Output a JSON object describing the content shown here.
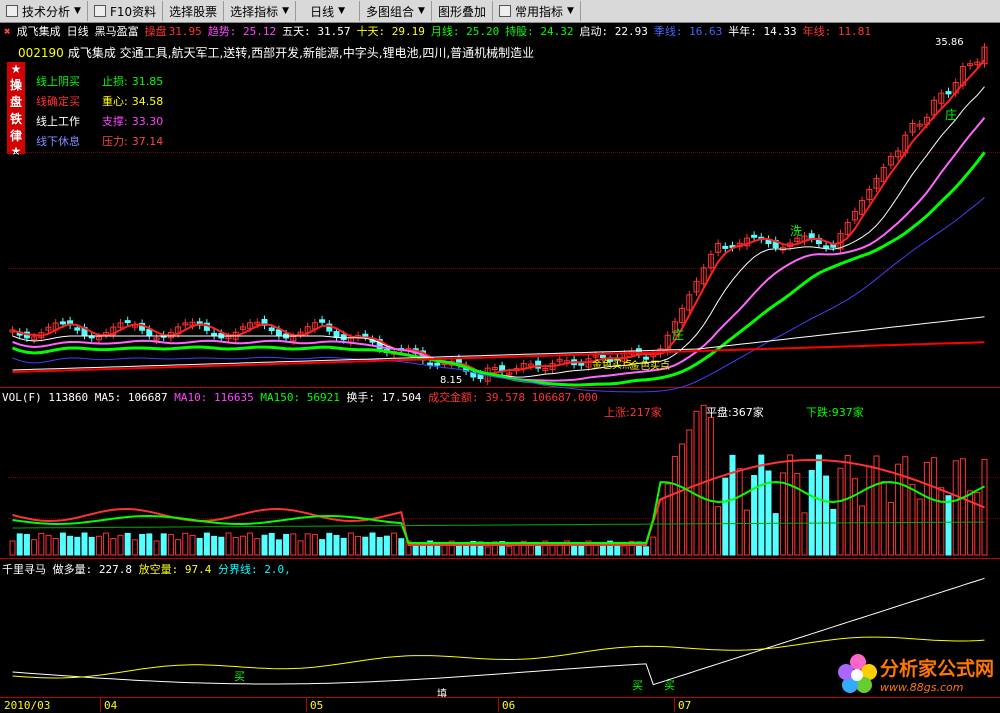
{
  "toolbar": {
    "items": [
      "技术分析",
      "F10资料",
      "选择股票",
      "选择指标",
      "日线",
      "多图组合",
      "图形叠加",
      "常用指标"
    ]
  },
  "titlebar": {
    "close_glyph": "✖",
    "stock_name": "成飞集成",
    "period": "日线",
    "formula": "黑马盈富",
    "operate_label": "操盘",
    "operate_value": "31.95",
    "trend": "趋势: 25.12",
    "day5": "五天: 31.57",
    "day10": "十天: 29.19",
    "month": "月线: 25.20",
    "hold": "持股: 24.32",
    "start": "启动: 22.93",
    "season": "季线: 16.63",
    "halfyear": "半年: 14.33",
    "year": "年线: 11.81"
  },
  "concept": {
    "code": "002190",
    "text": "成飞集成 交通工具,航天军工,送转,西部开发,新能源,中字头,锂电池,四川,普通机械制造业"
  },
  "badge": [
    "★",
    "操",
    "盘",
    "铁",
    "律",
    "★"
  ],
  "legend": [
    {
      "label": "线上阴买",
      "name": "止损:",
      "value": "31.85",
      "label_color": "#00ff00",
      "name_color": "#00ff00"
    },
    {
      "label": "线确定买",
      "name": "重心:",
      "value": "34.58",
      "label_color": "#ff3333",
      "name_color": "#ffff00"
    },
    {
      "label": "线上工作",
      "name": "支撑:",
      "value": "33.30",
      "label_color": "#ffffff",
      "name_color": "#ff44ff"
    },
    {
      "label": "线下休息",
      "name": "压力:",
      "value": "37.14",
      "label_color": "#8888ff",
      "name_color": "#ff4444"
    }
  ],
  "chart_annotations": {
    "top_right": "35.86",
    "low_mark": "8.15",
    "buy_labels": [
      "金色买点",
      "金色买点"
    ],
    "zhuang": "庄",
    "xi": "洗"
  },
  "volume": {
    "title": "VOL(F)",
    "vol": "113860",
    "ma5": "MA5: 106687",
    "ma10": "MA10: 116635",
    "ma150": "MA150: 56921",
    "turnover": "换手: 17.504",
    "amount_label": "成交金额: 39.578",
    "amount_value": "106687.000",
    "up": "上涨:217家",
    "flat": "平盘:367家",
    "down": "下跌:937家"
  },
  "indicator": {
    "title": "千里寻马",
    "long": "做多量: 227.8",
    "short": "放空量: 97.4",
    "divide": "分界线: 2.0,",
    "buy_mark": "买",
    "buy_mark2": "买",
    "buy_mark3": "买",
    "sell_mark": "填"
  },
  "dates": [
    "2010/03",
    "04",
    "05",
    "06",
    "07"
  ],
  "watermark": {
    "main": "分析家公式网",
    "url": "www.88gs.com"
  },
  "colors": {
    "up": "#ff3232",
    "down": "#54ffff",
    "grid": "#7a0000",
    "bg": "#000000"
  }
}
